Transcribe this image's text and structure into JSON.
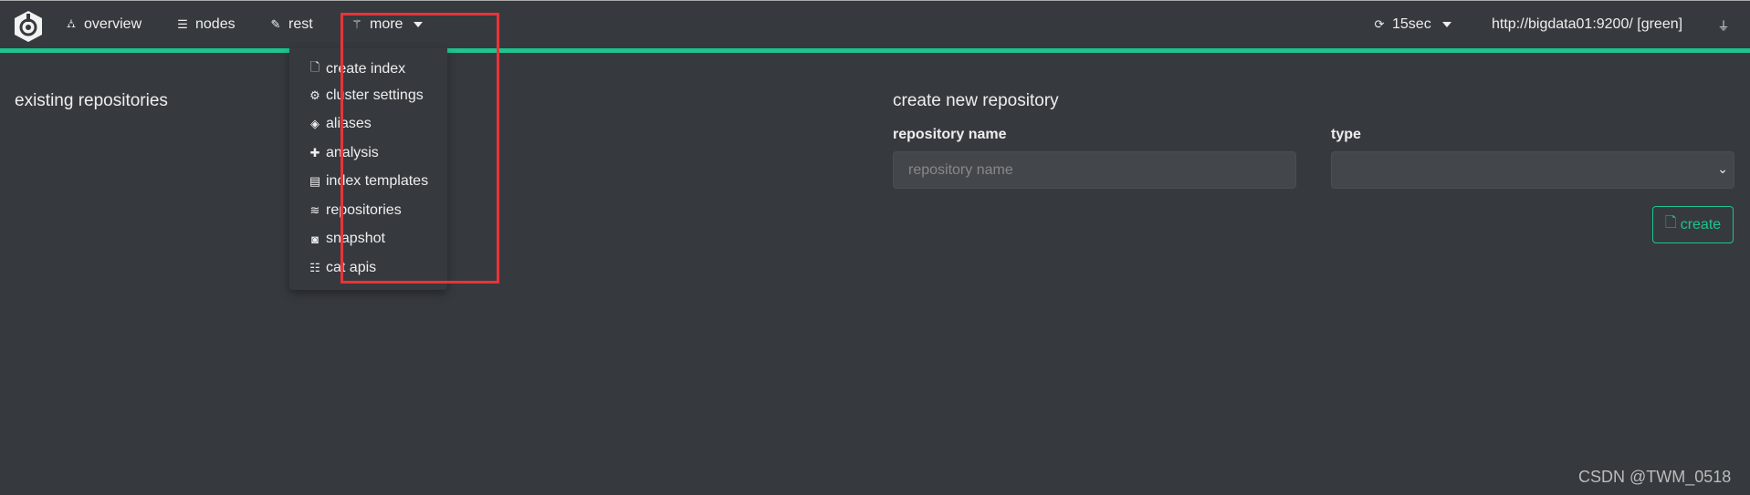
{
  "nav": {
    "items": [
      {
        "label": "overview",
        "icon": "sitemap-icon"
      },
      {
        "label": "nodes",
        "icon": "server-icon"
      },
      {
        "label": "rest",
        "icon": "edit-icon"
      },
      {
        "label": "more",
        "icon": "magic-icon"
      }
    ],
    "refresh": "15sec",
    "cluster": "http://bigdata01:9200/ [green]"
  },
  "dropdown": {
    "items": [
      {
        "label": "create index",
        "icon": "file-icon"
      },
      {
        "label": "cluster settings",
        "icon": "cogs-icon"
      },
      {
        "label": "aliases",
        "icon": "tags-icon"
      },
      {
        "label": "analysis",
        "icon": "puzzle-icon"
      },
      {
        "label": "index templates",
        "icon": "book-icon"
      },
      {
        "label": "repositories",
        "icon": "database-icon"
      },
      {
        "label": "snapshot",
        "icon": "camera-icon"
      },
      {
        "label": "cat apis",
        "icon": "list-icon"
      }
    ]
  },
  "main": {
    "existing_title": "existing repositories",
    "create_title": "create new repository",
    "name_label": "repository name",
    "name_placeholder": "repository name",
    "type_label": "type",
    "create_label": "create"
  },
  "watermark": "CSDN @TWM_0518",
  "colors": {
    "accent": "#1fc48e",
    "background": "#363a3e",
    "highlight_box": "#e8343a"
  }
}
